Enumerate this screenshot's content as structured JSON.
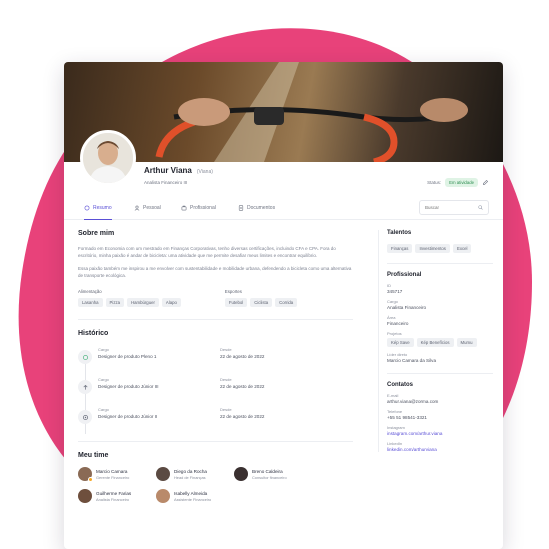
{
  "colors": {
    "accent": "#5a4fd6",
    "blob": "#e8427a",
    "status_green": "#2f8f52"
  },
  "profile": {
    "name": "Arthur Viana",
    "nickname": "(Viana)",
    "role": "Analista Financeiro III",
    "status_label": "Status:",
    "status_value": "Em atividade"
  },
  "tabs": [
    {
      "label": "Resumo",
      "icon": "home-icon"
    },
    {
      "label": "Pessoal",
      "icon": "user-icon"
    },
    {
      "label": "Profissional",
      "icon": "briefcase-icon"
    },
    {
      "label": "Documentos",
      "icon": "document-icon"
    }
  ],
  "search": {
    "placeholder": "Buscar"
  },
  "about": {
    "title": "Sobre mim",
    "paragraph1": "Formado em Economia com um mestrado em Finanças Corporativas, tenho diversas certificações, incluindo CFA e CPA. Fora do escritório, minha paixão é andar de bicicleta: uma atividade que me permite desafiar meus limites e encontrar equilíbrio.",
    "paragraph2": "Essa paixão também me inspirou a me envolver com sustentabilidade e mobilidade urbana, defendendo a bicicleta como uma alternativa de transporte ecológica.",
    "food_label": "Alimentação",
    "food": [
      "Lasanha",
      "Pizza",
      "Hambúrguer",
      "Alapo"
    ],
    "sports_label": "Esportes",
    "sports": [
      "Futebol",
      "Ciclista",
      "Corrida"
    ]
  },
  "history": {
    "title": "Histórico",
    "cargo_label": "Cargo",
    "desde_label": "Desde",
    "items": [
      {
        "cargo": "Designer de produto Pleno 1",
        "desde": "22 de agosto de 2022"
      },
      {
        "cargo": "Designer de produto Júnior III",
        "desde": "22 de agosto de 2022"
      },
      {
        "cargo": "Designer de produto Júnior II",
        "desde": "22 de agosto de 2022"
      }
    ]
  },
  "team": {
    "title": "Meu time",
    "members": [
      {
        "name": "Marcio Camara",
        "role": "Gerente Financeiro",
        "color": "#8a6a55"
      },
      {
        "name": "Diego da Rocha",
        "role": "Head de Finanças",
        "color": "#5b4a42"
      },
      {
        "name": "Breno Caldeira",
        "role": "Consultor financeiro",
        "color": "#3a3030"
      },
      {
        "name": "Guilherme Farias",
        "role": "Analista Financeiro",
        "color": "#6e4f3d"
      },
      {
        "name": "Isabelly Almeida",
        "role": "Assistente Financeiro",
        "color": "#b98a6a"
      }
    ]
  },
  "sidebar": {
    "talents_title": "Talentos",
    "talents": [
      "Finanças",
      "Investimentos",
      "Excel"
    ],
    "pro_title": "Profissional",
    "id_label": "ID",
    "id_value": "345717",
    "cargo_label": "Cargo",
    "cargo_value": "Analista Financeiro",
    "area_label": "Área",
    "area_value": "Financeiro",
    "projetos_label": "Projetos",
    "projetos": [
      "Kép Save",
      "Kép Benefícios",
      "Mumu"
    ],
    "lider_label": "Líder direto",
    "lider_value": "Marcio Camara da Silva",
    "contacts_title": "Contatos",
    "email_label": "E-mail",
    "email_value": "arthur.viana@zorma.com",
    "phone_label": "Telefone",
    "phone_value": "+55 51 98541-3321",
    "instagram_label": "Instagram",
    "instagram_value": "instagram.com/arthur.viana",
    "linkedin_label": "LinkedIn",
    "linkedin_value": "linkedin.com/arthurviana"
  }
}
